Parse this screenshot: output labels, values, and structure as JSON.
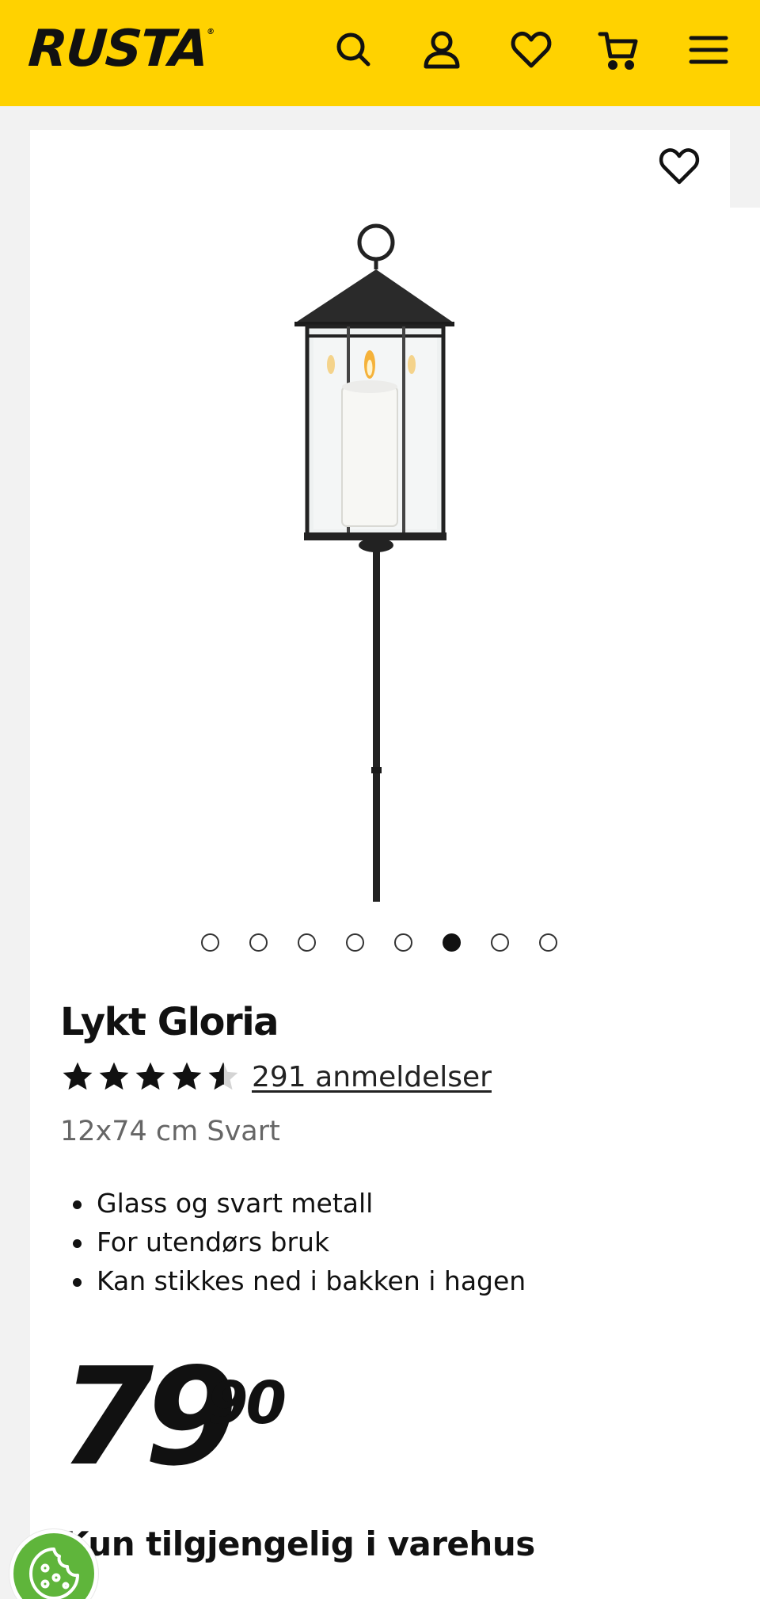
{
  "header": {
    "brand": "RUSTA",
    "brand_mark": "®",
    "icons": [
      "search-icon",
      "account-icon",
      "heart-icon",
      "cart-icon",
      "menu-icon"
    ],
    "background": "#ffd200"
  },
  "gallery": {
    "total_images": 8,
    "active_index": 5
  },
  "product": {
    "title": "Lykt Gloria",
    "rating": 4.5,
    "reviews_text": "291 anmeldelser",
    "variant": "12x74 cm Svart",
    "features": [
      "Glass og svart metall",
      "For utendørs bruk",
      "Kan stikkes ned i bakken i hagen"
    ],
    "price_main": "79",
    "price_decimals": "90",
    "availability": "Kun tilgjengelig i varehus"
  },
  "cookie_button": {
    "icon": "cookie-icon",
    "color": "#5fb53b"
  }
}
